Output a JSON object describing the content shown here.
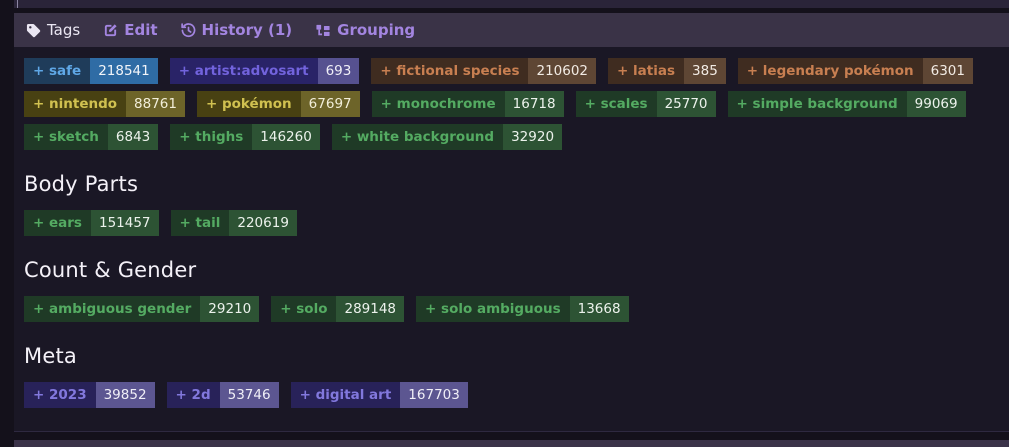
{
  "toolbar": {
    "items": [
      {
        "label": "Tags",
        "icon": "tag-icon"
      },
      {
        "label": "Edit",
        "icon": "edit-icon"
      },
      {
        "label": "History (1)",
        "icon": "history-icon"
      },
      {
        "label": "Grouping",
        "icon": "grouping-icon"
      }
    ]
  },
  "tag_prefix": "+",
  "colors": {
    "toolbar_bg": "#3a3347",
    "toolbar_link": "#a385e0",
    "toolbar_plain": "#eae6f2",
    "panel_bg": "#1a1725",
    "page_bg": "#14111b",
    "rating": {
      "bg": "#1f3c5a",
      "fg": "#5fa7e6",
      "count_bg": "#2f6ca5",
      "count_fg": "#f2f5f9"
    },
    "artist": {
      "bg": "#292367",
      "fg": "#7263dd",
      "count_bg": "#565190",
      "count_fg": "#f0eff7"
    },
    "species": {
      "bg": "#3f2c20",
      "fg": "#c87f51",
      "count_bg": "#5e4634",
      "count_fg": "#f2ebe4"
    },
    "copyright": {
      "bg": "#484112",
      "fg": "#d0c150",
      "count_bg": "#6d6429",
      "count_fg": "#f2eed9"
    },
    "general": {
      "bg": "#1f3a26",
      "fg": "#54ab62",
      "count_bg": "#2d5334",
      "count_fg": "#ecf2ec"
    },
    "meta": {
      "bg": "#282259",
      "fg": "#8278dd",
      "count_bg": "#5c5691",
      "count_fg": "#f0eff7"
    }
  },
  "groups": [
    {
      "header": "",
      "rows": [
        [
          {
            "name": "safe",
            "count": "218541",
            "category": "rating"
          },
          {
            "name": "artist:advosart",
            "count": "693",
            "category": "artist"
          },
          {
            "name": "fictional species",
            "count": "210602",
            "category": "species"
          },
          {
            "name": "latias",
            "count": "385",
            "category": "species"
          },
          {
            "name": "legendary pokémon",
            "count": "6301",
            "category": "species"
          }
        ],
        [
          {
            "name": "nintendo",
            "count": "88761",
            "category": "copyright"
          },
          {
            "name": "pokémon",
            "count": "67697",
            "category": "copyright"
          },
          {
            "name": "monochrome",
            "count": "16718",
            "category": "general"
          },
          {
            "name": "scales",
            "count": "25770",
            "category": "general"
          },
          {
            "name": "simple background",
            "count": "99069",
            "category": "general"
          }
        ],
        [
          {
            "name": "sketch",
            "count": "6843",
            "category": "general"
          },
          {
            "name": "thighs",
            "count": "146260",
            "category": "general"
          },
          {
            "name": "white background",
            "count": "32920",
            "category": "general"
          }
        ]
      ]
    },
    {
      "header": "Body Parts",
      "rows": [
        [
          {
            "name": "ears",
            "count": "151457",
            "category": "general"
          },
          {
            "name": "tail",
            "count": "220619",
            "category": "general"
          }
        ]
      ]
    },
    {
      "header": "Count & Gender",
      "rows": [
        [
          {
            "name": "ambiguous gender",
            "count": "29210",
            "category": "general"
          },
          {
            "name": "solo",
            "count": "289148",
            "category": "general"
          },
          {
            "name": "solo ambiguous",
            "count": "13668",
            "category": "general"
          }
        ]
      ]
    },
    {
      "header": "Meta",
      "rows": [
        [
          {
            "name": "2023",
            "count": "39852",
            "category": "meta"
          },
          {
            "name": "2d",
            "count": "53746",
            "category": "meta"
          },
          {
            "name": "digital art",
            "count": "167703",
            "category": "meta"
          }
        ]
      ]
    }
  ]
}
